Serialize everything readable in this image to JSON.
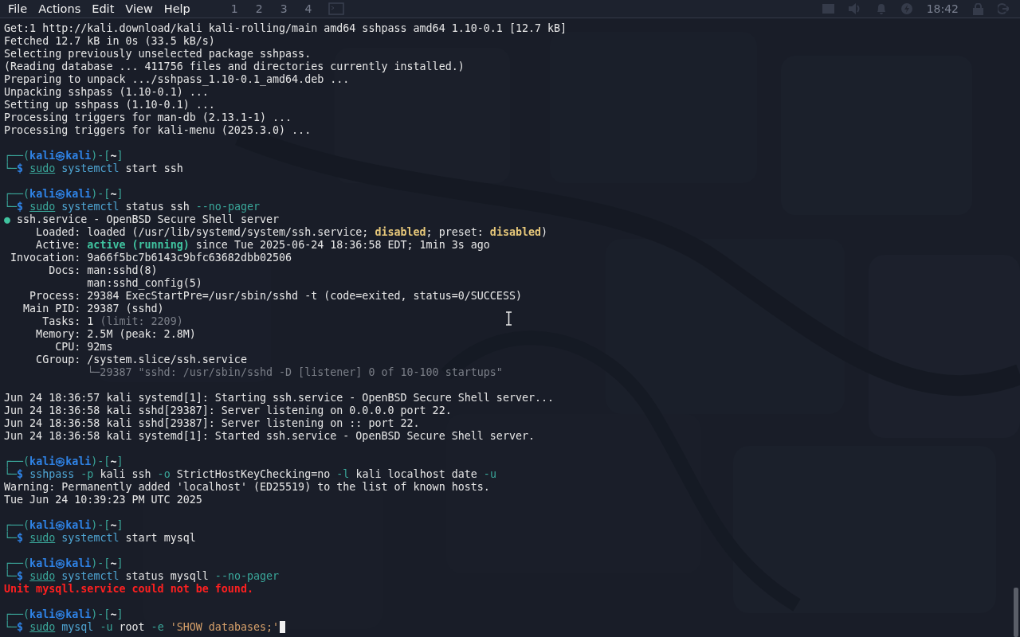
{
  "menubar": {
    "items": [
      "File",
      "Actions",
      "Edit",
      "View",
      "Help"
    ]
  },
  "desktop_panel": {
    "workspaces": [
      "1",
      "2",
      "3",
      "4"
    ],
    "clock": "18:42"
  },
  "terminal": {
    "lines": [
      {
        "kind": "output",
        "segments": [
          {
            "text": "Get:1 http://kali.download/kali kali-rolling/main amd64 sshpass amd64 1.10-0.1 [12.7 kB]",
            "kind": "plain"
          }
        ]
      },
      {
        "kind": "output",
        "segments": [
          {
            "text": "Fetched 12.7 kB in 0s (33.5 kB/s)",
            "kind": "plain"
          }
        ]
      },
      {
        "kind": "output",
        "segments": [
          {
            "text": "Selecting previously unselected package sshpass.",
            "kind": "plain"
          }
        ]
      },
      {
        "kind": "output",
        "segments": [
          {
            "text": "(Reading database ... 411756 files and directories currently installed.)",
            "kind": "plain"
          }
        ]
      },
      {
        "kind": "output",
        "segments": [
          {
            "text": "Preparing to unpack .../sshpass_1.10-0.1_amd64.deb ...",
            "kind": "plain"
          }
        ]
      },
      {
        "kind": "output",
        "segments": [
          {
            "text": "Unpacking sshpass (1.10-0.1) ...",
            "kind": "plain"
          }
        ]
      },
      {
        "kind": "output",
        "segments": [
          {
            "text": "Setting up sshpass (1.10-0.1) ...",
            "kind": "plain"
          }
        ]
      },
      {
        "kind": "output",
        "segments": [
          {
            "text": "Processing triggers for man-db (2.13.1-1) ...",
            "kind": "plain"
          }
        ]
      },
      {
        "kind": "output",
        "segments": [
          {
            "text": "Processing triggers for kali-menu (2025.3.0) ...",
            "kind": "plain"
          }
        ]
      },
      {
        "kind": "blank"
      },
      {
        "kind": "prompt",
        "segments": [
          {
            "text": "┌──(",
            "kind": "frame"
          },
          {
            "text": "kali㉿kali",
            "kind": "user"
          },
          {
            "text": ")-[",
            "kind": "frame"
          },
          {
            "text": "~",
            "kind": "dir"
          },
          {
            "text": "]",
            "kind": "frame"
          }
        ]
      },
      {
        "kind": "command",
        "segments": [
          {
            "text": "└─",
            "kind": "frame"
          },
          {
            "text": "$ ",
            "kind": "sign"
          },
          {
            "text": "sudo",
            "kind": "sudo"
          },
          {
            "text": " systemctl",
            "kind": "cmd"
          },
          {
            "text": " start ssh",
            "kind": "plain"
          }
        ]
      },
      {
        "kind": "blank"
      },
      {
        "kind": "prompt",
        "segments": [
          {
            "text": "┌──(",
            "kind": "frame"
          },
          {
            "text": "kali㉿kali",
            "kind": "user"
          },
          {
            "text": ")-[",
            "kind": "frame"
          },
          {
            "text": "~",
            "kind": "dir"
          },
          {
            "text": "]",
            "kind": "frame"
          }
        ]
      },
      {
        "kind": "command",
        "segments": [
          {
            "text": "└─",
            "kind": "frame"
          },
          {
            "text": "$ ",
            "kind": "sign"
          },
          {
            "text": "sudo",
            "kind": "sudo"
          },
          {
            "text": " systemctl",
            "kind": "cmd"
          },
          {
            "text": " status ssh ",
            "kind": "plain"
          },
          {
            "text": "--no-pager",
            "kind": "option"
          }
        ]
      },
      {
        "kind": "output",
        "segments": [
          {
            "text": "●",
            "kind": "dot"
          },
          {
            "text": " ssh.service - OpenBSD Secure Shell server",
            "kind": "plain"
          }
        ]
      },
      {
        "kind": "output",
        "segments": [
          {
            "text": "     Loaded: loaded (/usr/lib/systemd/system/ssh.service; ",
            "kind": "plain"
          },
          {
            "text": "disabled",
            "kind": "warn"
          },
          {
            "text": "; preset: ",
            "kind": "plain"
          },
          {
            "text": "disabled",
            "kind": "warn"
          },
          {
            "text": ")",
            "kind": "plain"
          }
        ]
      },
      {
        "kind": "output",
        "segments": [
          {
            "text": "     Active: ",
            "kind": "plain"
          },
          {
            "text": "active (running)",
            "kind": "ok"
          },
          {
            "text": " since Tue 2025-06-24 18:36:58 EDT; 1min 3s ago",
            "kind": "plain"
          }
        ]
      },
      {
        "kind": "output",
        "segments": [
          {
            "text": " Invocation: 9a66f5bc7b6143c9bfc63682dbb02506",
            "kind": "plain"
          }
        ]
      },
      {
        "kind": "output",
        "segments": [
          {
            "text": "       Docs: man:sshd(8)",
            "kind": "plain"
          }
        ]
      },
      {
        "kind": "output",
        "segments": [
          {
            "text": "             man:sshd_config(5)",
            "kind": "plain"
          }
        ]
      },
      {
        "kind": "output",
        "segments": [
          {
            "text": "    Process: 29384 ExecStartPre=/usr/sbin/sshd -t (code=exited, status=0/SUCCESS)",
            "kind": "plain"
          }
        ]
      },
      {
        "kind": "output",
        "segments": [
          {
            "text": "   Main PID: 29387 (sshd)",
            "kind": "plain"
          }
        ]
      },
      {
        "kind": "output",
        "segments": [
          {
            "text": "      Tasks: 1 ",
            "kind": "plain"
          },
          {
            "text": "(limit: 2209)",
            "kind": "dim"
          }
        ]
      },
      {
        "kind": "output",
        "segments": [
          {
            "text": "     Memory: 2.5M (peak: 2.8M)",
            "kind": "plain"
          }
        ]
      },
      {
        "kind": "output",
        "segments": [
          {
            "text": "        CPU: 92ms",
            "kind": "plain"
          }
        ]
      },
      {
        "kind": "output",
        "segments": [
          {
            "text": "     CGroup: /system.slice/ssh.service",
            "kind": "plain"
          }
        ]
      },
      {
        "kind": "output",
        "segments": [
          {
            "text": "             └─29387 \"sshd: /usr/sbin/sshd -D [listener] 0 of 10-100 startups\"",
            "kind": "dim"
          }
        ]
      },
      {
        "kind": "blank"
      },
      {
        "kind": "output",
        "segments": [
          {
            "text": "Jun 24 18:36:57 kali systemd[1]: Starting ssh.service - OpenBSD Secure Shell server...",
            "kind": "plain"
          }
        ]
      },
      {
        "kind": "output",
        "segments": [
          {
            "text": "Jun 24 18:36:58 kali sshd[29387]: Server listening on 0.0.0.0 port 22.",
            "kind": "plain"
          }
        ]
      },
      {
        "kind": "output",
        "segments": [
          {
            "text": "Jun 24 18:36:58 kali sshd[29387]: Server listening on :: port 22.",
            "kind": "plain"
          }
        ]
      },
      {
        "kind": "output",
        "segments": [
          {
            "text": "Jun 24 18:36:58 kali systemd[1]: Started ssh.service - OpenBSD Secure Shell server.",
            "kind": "plain"
          }
        ]
      },
      {
        "kind": "blank"
      },
      {
        "kind": "prompt",
        "segments": [
          {
            "text": "┌──(",
            "kind": "frame"
          },
          {
            "text": "kali㉿kali",
            "kind": "user"
          },
          {
            "text": ")-[",
            "kind": "frame"
          },
          {
            "text": "~",
            "kind": "dir"
          },
          {
            "text": "]",
            "kind": "frame"
          }
        ]
      },
      {
        "kind": "command",
        "segments": [
          {
            "text": "└─",
            "kind": "frame"
          },
          {
            "text": "$ ",
            "kind": "sign"
          },
          {
            "text": "sshpass",
            "kind": "cmd"
          },
          {
            "text": " -p",
            "kind": "option"
          },
          {
            "text": " kali ssh",
            "kind": "plain"
          },
          {
            "text": " -o",
            "kind": "option"
          },
          {
            "text": " StrictHostKeyChecking=no",
            "kind": "plain"
          },
          {
            "text": " -l",
            "kind": "option"
          },
          {
            "text": " kali localhost date",
            "kind": "plain"
          },
          {
            "text": " -u",
            "kind": "option"
          }
        ]
      },
      {
        "kind": "output",
        "segments": [
          {
            "text": "Warning: Permanently added 'localhost' (ED25519) to the list of known hosts.",
            "kind": "plain"
          }
        ]
      },
      {
        "kind": "output",
        "segments": [
          {
            "text": "Tue Jun 24 10:39:23 PM UTC 2025",
            "kind": "plain"
          }
        ]
      },
      {
        "kind": "blank"
      },
      {
        "kind": "prompt",
        "segments": [
          {
            "text": "┌──(",
            "kind": "frame"
          },
          {
            "text": "kali㉿kali",
            "kind": "user"
          },
          {
            "text": ")-[",
            "kind": "frame"
          },
          {
            "text": "~",
            "kind": "dir"
          },
          {
            "text": "]",
            "kind": "frame"
          }
        ]
      },
      {
        "kind": "command",
        "segments": [
          {
            "text": "└─",
            "kind": "frame"
          },
          {
            "text": "$ ",
            "kind": "sign"
          },
          {
            "text": "sudo",
            "kind": "sudo"
          },
          {
            "text": " systemctl",
            "kind": "cmd"
          },
          {
            "text": " start mysql",
            "kind": "plain"
          }
        ]
      },
      {
        "kind": "blank"
      },
      {
        "kind": "prompt",
        "segments": [
          {
            "text": "┌──(",
            "kind": "frame"
          },
          {
            "text": "kali㉿kali",
            "kind": "user"
          },
          {
            "text": ")-[",
            "kind": "frame"
          },
          {
            "text": "~",
            "kind": "dir"
          },
          {
            "text": "]",
            "kind": "frame"
          }
        ]
      },
      {
        "kind": "command",
        "segments": [
          {
            "text": "└─",
            "kind": "frame"
          },
          {
            "text": "$ ",
            "kind": "sign"
          },
          {
            "text": "sudo",
            "kind": "sudo"
          },
          {
            "text": " systemctl",
            "kind": "cmd"
          },
          {
            "text": " status mysqll ",
            "kind": "plain"
          },
          {
            "text": "--no-pager",
            "kind": "option"
          }
        ]
      },
      {
        "kind": "output",
        "segments": [
          {
            "text": "Unit mysqll.service could not be found.",
            "kind": "error"
          }
        ]
      },
      {
        "kind": "blank"
      },
      {
        "kind": "prompt",
        "segments": [
          {
            "text": "┌──(",
            "kind": "frame"
          },
          {
            "text": "kali㉿kali",
            "kind": "user"
          },
          {
            "text": ")-[",
            "kind": "frame"
          },
          {
            "text": "~",
            "kind": "dir"
          },
          {
            "text": "]",
            "kind": "frame"
          }
        ]
      },
      {
        "kind": "command",
        "cursor": true,
        "segments": [
          {
            "text": "└─",
            "kind": "frame"
          },
          {
            "text": "$ ",
            "kind": "sign"
          },
          {
            "text": "sudo",
            "kind": "sudo"
          },
          {
            "text": " mysql",
            "kind": "cmd"
          },
          {
            "text": " -u",
            "kind": "option"
          },
          {
            "text": " root",
            "kind": "plain"
          },
          {
            "text": " -e",
            "kind": "option"
          },
          {
            "text": " 'SHOW databases;'",
            "kind": "string"
          }
        ]
      }
    ]
  }
}
